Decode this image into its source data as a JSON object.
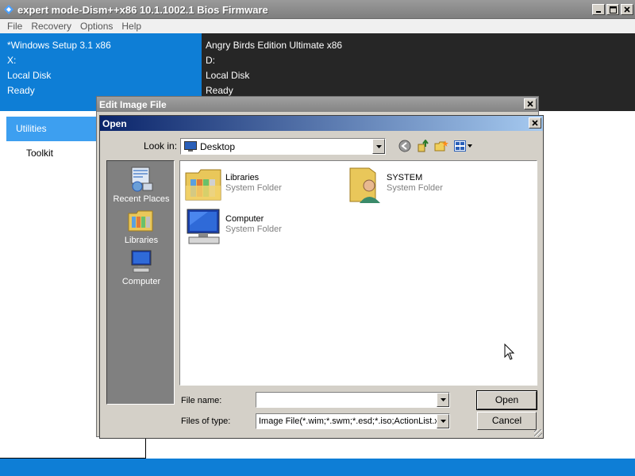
{
  "window": {
    "title": "expert mode-Dism++x86 10.1.1002.1 Bios Firmware"
  },
  "menu": [
    "File",
    "Recovery",
    "Options",
    "Help"
  ],
  "images": {
    "left": {
      "name": "*Windows Setup 3.1 x86",
      "drive": "X:",
      "disk": "Local Disk",
      "status": "Ready"
    },
    "right": {
      "name": "Angry Birds Edition Ultimate x86",
      "drive": "D:",
      "disk": "Local Disk",
      "status": "Ready"
    }
  },
  "sidebar": {
    "items": [
      "Utilities",
      "Toolkit"
    ],
    "selected": "Utilities"
  },
  "edit_dialog": {
    "title": "Edit Image File"
  },
  "open_dialog": {
    "title": "Open",
    "look_in_label": "Look in:",
    "look_in_value": "Desktop",
    "places": [
      "Recent Places",
      "Libraries",
      "Computer"
    ],
    "files": [
      {
        "name": "Libraries",
        "type": "System Folder",
        "icon": "libraries-folder-icon"
      },
      {
        "name": "SYSTEM",
        "type": "System Folder",
        "icon": "user-folder-icon"
      },
      {
        "name": "Computer",
        "type": "System Folder",
        "icon": "computer-icon"
      }
    ],
    "file_name_label": "File name:",
    "file_name_value": "",
    "file_type_label": "Files of type:",
    "file_type_value": "Image File(*.wim;*.swm;*.esd;*.iso;ActionList.xml",
    "open_button": "Open",
    "cancel_button": "Cancel"
  },
  "colors": {
    "accent_blue": "#0e7ed6",
    "dark_pane": "#262626",
    "selected_nav": "#3d9ff0"
  }
}
